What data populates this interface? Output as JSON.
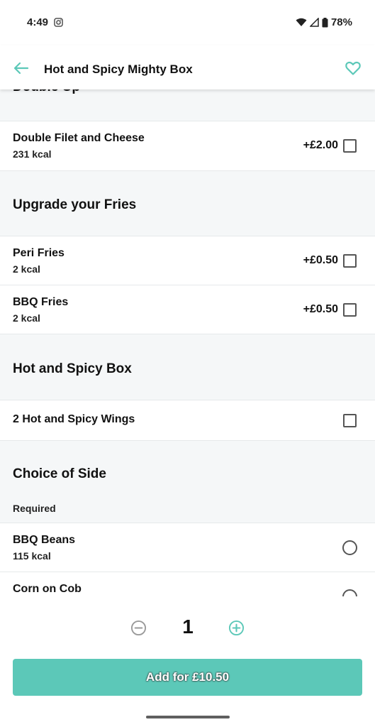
{
  "status_bar": {
    "time": "4:49",
    "battery": "78%",
    "icons": [
      "instagram-icon",
      "wifi-icon",
      "signal-icon",
      "battery-icon"
    ]
  },
  "header": {
    "title": "Hot and Spicy Mighty Box",
    "back_icon": "arrow-left-icon",
    "favorite_icon": "heart-outline-icon",
    "accent_color": "#5cc8b8"
  },
  "sections": {
    "double_up": {
      "title": "Double Up",
      "options": [
        {
          "name": "Double Filet and Cheese",
          "kcal": "231 kcal",
          "price": "+£2.00"
        }
      ]
    },
    "fries": {
      "title": "Upgrade your Fries",
      "options": [
        {
          "name": "Peri Fries",
          "kcal": "2 kcal",
          "price": "+£0.50"
        },
        {
          "name": "BBQ Fries",
          "kcal": "2 kcal",
          "price": "+£0.50"
        }
      ]
    },
    "box": {
      "title": "Hot and Spicy Box",
      "options": [
        {
          "name": "2 Hot and Spicy Wings"
        }
      ]
    },
    "side": {
      "title": "Choice of Side",
      "subtitle": "Required",
      "options": [
        {
          "name": "BBQ Beans",
          "kcal": "115 kcal"
        },
        {
          "name": "Corn on Cob"
        }
      ]
    }
  },
  "footer": {
    "quantity": "1",
    "add_label": "Add for £10.50",
    "button_color": "#5cc8b8"
  }
}
